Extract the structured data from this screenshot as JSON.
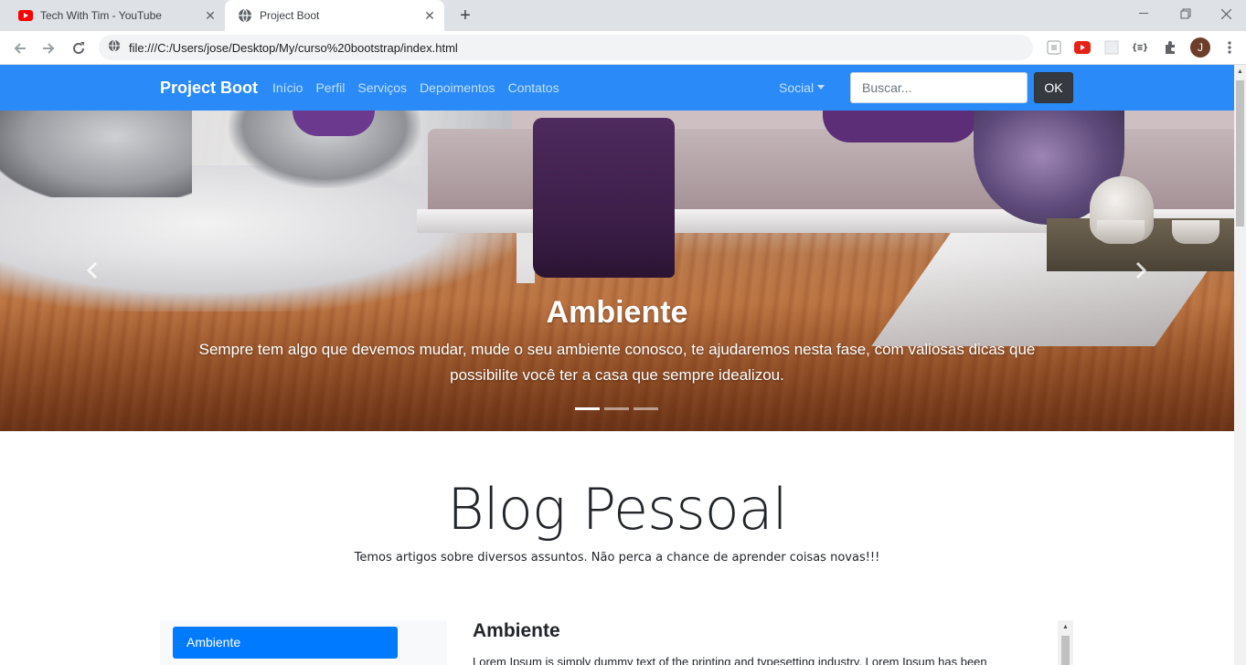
{
  "browser": {
    "tabs": [
      {
        "title": "Tech With Tim - YouTube",
        "icon": "youtube-icon"
      },
      {
        "title": "Project Boot",
        "icon": "globe-icon"
      }
    ],
    "url": "file:///C:/Users/jose/Desktop/My/curso%20bootstrap/index.html",
    "profile_initial": "J"
  },
  "navbar": {
    "brand": "Project Boot",
    "links": [
      "Início",
      "Perfil",
      "Serviços",
      "Depoimentos",
      "Contatos"
    ],
    "dropdown": "Social",
    "search_placeholder": "Buscar...",
    "search_button": "OK",
    "color": "#2a8af8"
  },
  "carousel": {
    "caption_title": "Ambiente",
    "caption_text": "Sempre tem algo que devemos mudar, mude o seu ambiente conosco, te ajudaremos nesta fase, com valiosas dicas que possibilite você ter a casa que sempre idealizou.",
    "slide_count": 3,
    "active_slide": 1
  },
  "blog": {
    "title": "Blog Pessoal",
    "subtitle": "Temos artigos sobre diversos assuntos. Não perca a chance de aprender coisas novas!!!"
  },
  "sidebar": {
    "active_item": "Ambiente",
    "active_color": "#007bff"
  },
  "article": {
    "heading": "Ambiente",
    "text": "Lorem Ipsum is simply dummy text of the printing and typesetting industry. Lorem Ipsum has been"
  }
}
